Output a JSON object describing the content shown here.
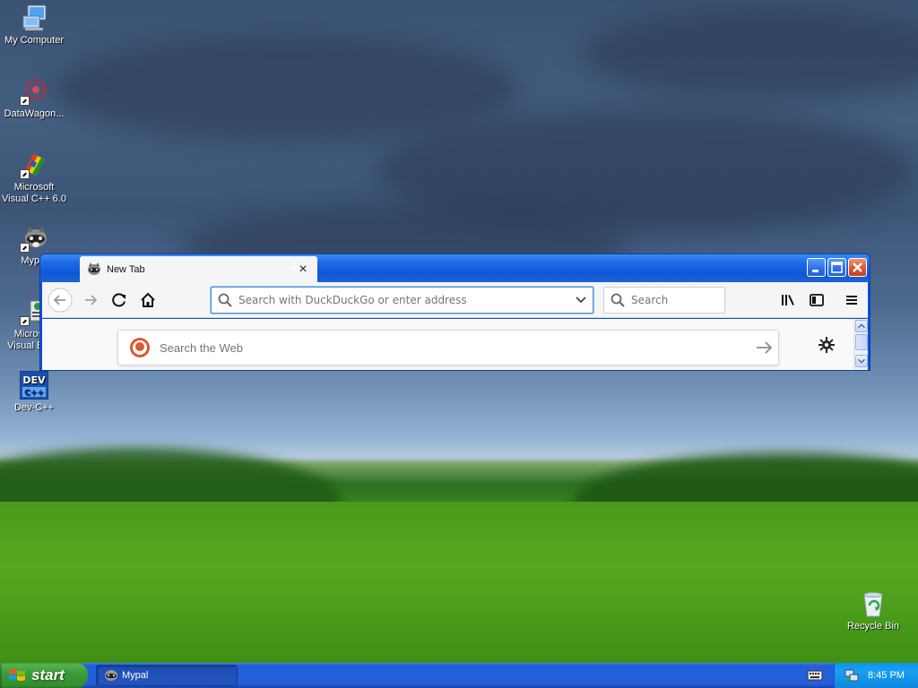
{
  "desktop": {
    "icons": [
      {
        "label": "My Computer"
      },
      {
        "label": "DataWagon..."
      },
      {
        "label": "Microsoft Visual C++ 6.0"
      },
      {
        "label": "Mypal"
      },
      {
        "label": "Microsoft Visual Basic"
      },
      {
        "label": "Dev-C++"
      },
      {
        "label": "Recycle Bin"
      }
    ]
  },
  "browser": {
    "tab": {
      "title": "New Tab",
      "icon": "mypal-raccoon-icon"
    },
    "new_tab_symbol": "+",
    "urlbar": {
      "placeholder": "Search with DuckDuckGo or enter address"
    },
    "searchbar": {
      "placeholder": "Search"
    },
    "newtab_page": {
      "search_placeholder": "Search the Web"
    }
  },
  "taskbar": {
    "start_label": "start",
    "items": [
      {
        "label": "Mypal"
      }
    ],
    "clock": "8:45 PM"
  },
  "colors": {
    "xp_blue": "#245edb",
    "start_green": "#3c9c3a",
    "tray_blue": "#0f87df",
    "close_red": "#d9532b"
  }
}
